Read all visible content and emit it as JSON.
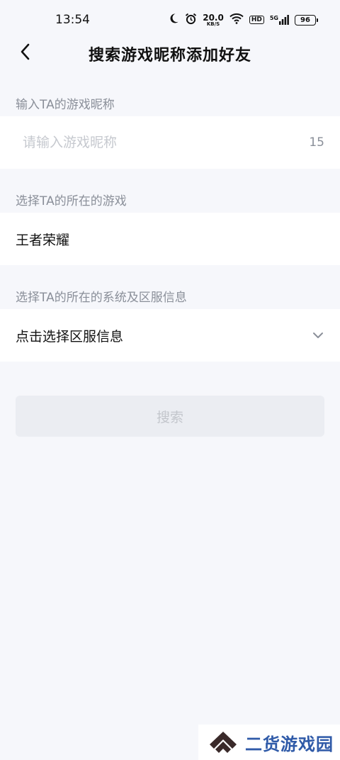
{
  "status_bar": {
    "time": "13:54",
    "net_speed_value": "20.0",
    "net_speed_unit": "KB/S",
    "hd_label": "HD",
    "signal_label": "5G",
    "battery": "96",
    "icons": [
      "moon-icon",
      "alarm-icon",
      "wifi-icon",
      "signal-icon",
      "battery-icon"
    ]
  },
  "header": {
    "title": "搜索游戏昵称添加好友"
  },
  "form": {
    "nickname_label": "输入TA的游戏昵称",
    "nickname_placeholder": "请输入游戏昵称",
    "nickname_value": "",
    "nickname_counter": "15",
    "game_label": "选择TA的所在的游戏",
    "game_value": "王者荣耀",
    "server_label": "选择TA的所在的系统及区服信息",
    "server_value": "点击选择区服信息"
  },
  "actions": {
    "search_label": "搜索"
  },
  "watermark": {
    "text": "二货游戏园"
  },
  "colors": {
    "background": "#f6f7fb",
    "row_background": "#ffffff",
    "label_gray": "#8a8f99",
    "placeholder_gray": "#c6c9cf",
    "button_disabled_bg": "#ebedf2",
    "button_disabled_text": "#c3c6cc",
    "watermark_blue": "#2f5aa8"
  }
}
